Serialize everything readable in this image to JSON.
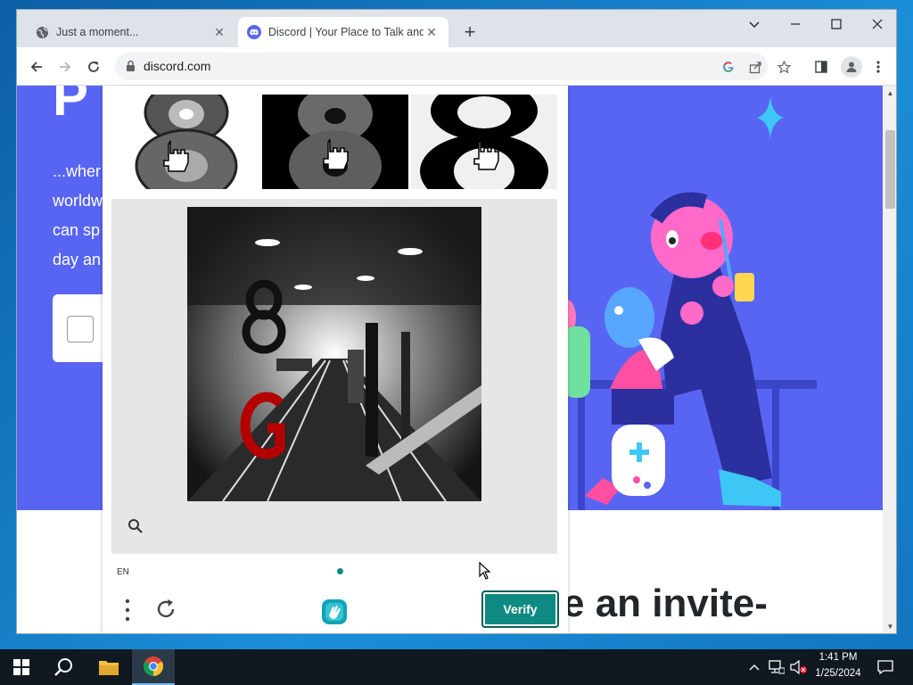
{
  "browser": {
    "tabs": [
      {
        "title": "Just a moment...",
        "icon": "globe-icon",
        "active": false
      },
      {
        "title": "Discord | Your Place to Talk and Hang Out",
        "icon": "discord-icon",
        "active": true
      }
    ],
    "address": "discord.com"
  },
  "page": {
    "hero_title_fragment": "P",
    "hero_text_lines": [
      "...wher",
      "worldw",
      "can sp",
      "day an"
    ],
    "invite_text": "e an invite-",
    "accent_color": "#5865f2"
  },
  "captcha": {
    "language": "EN",
    "verify_label": "Verify",
    "accent_color": "#0f8a82"
  },
  "taskbar": {
    "time": "1:41 PM",
    "date": "1/25/2024"
  }
}
